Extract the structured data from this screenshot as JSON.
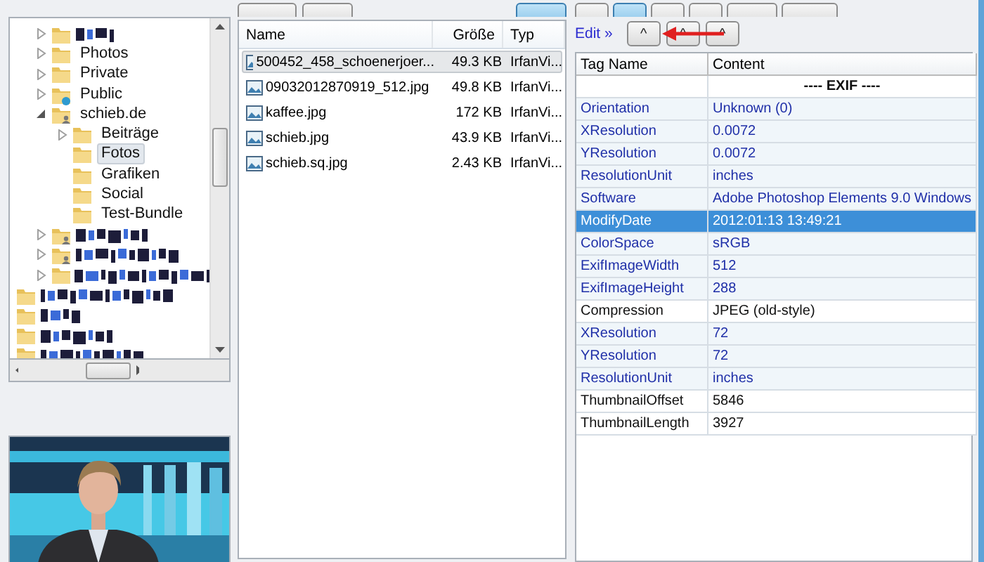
{
  "tree": {
    "items": [
      {
        "blurred": true,
        "expandable": true,
        "expanded": false,
        "kind": "folder"
      },
      {
        "label": "Photos",
        "expandable": true,
        "expanded": false,
        "kind": "folder",
        "selected": false
      },
      {
        "label": "Private",
        "expandable": true,
        "expanded": false,
        "kind": "folder",
        "selected": false
      },
      {
        "label": "Public",
        "expandable": true,
        "expanded": false,
        "kind": "public",
        "selected": false
      },
      {
        "label": "schieb.de",
        "expandable": true,
        "expanded": true,
        "kind": "shared",
        "selected": false,
        "children": [
          {
            "label": "Beiträge",
            "expandable": true,
            "expanded": false,
            "kind": "folder",
            "selected": false
          },
          {
            "label": "Fotos",
            "expandable": false,
            "kind": "folder",
            "selected": true
          },
          {
            "label": "Grafiken",
            "expandable": false,
            "kind": "folder",
            "selected": false
          },
          {
            "label": "Social",
            "expandable": false,
            "kind": "folder",
            "selected": false
          },
          {
            "label": "Test-Bundle",
            "expandable": false,
            "kind": "folder",
            "selected": false
          }
        ]
      },
      {
        "blurred": true,
        "expandable": true,
        "expanded": false,
        "kind": "shared"
      },
      {
        "blurred": true,
        "expandable": true,
        "expanded": false,
        "kind": "shared"
      },
      {
        "blurred": true,
        "expandable": true,
        "expanded": false,
        "kind": "folder"
      }
    ],
    "outer_items": [
      {
        "blurred": true,
        "kind": "folder"
      },
      {
        "blurred": true,
        "kind": "folder"
      },
      {
        "blurred": true,
        "kind": "folder"
      },
      {
        "blurred": true,
        "kind": "folder"
      }
    ]
  },
  "preview": {
    "kind": "picture"
  },
  "files": {
    "columns": [
      "Name",
      "Größe",
      "Typ"
    ],
    "rows": [
      {
        "name": "500452_458_schoenerjoer...",
        "size": "49.3 KB",
        "type": "IrfanVi...",
        "selected": true
      },
      {
        "name": "09032012870919_512.jpg",
        "size": "49.8 KB",
        "type": "IrfanVi...",
        "selected": false
      },
      {
        "name": "kaffee.jpg",
        "size": "172 KB",
        "type": "IrfanVi...",
        "selected": false
      },
      {
        "name": "schieb.jpg",
        "size": "43.9 KB",
        "type": "IrfanVi...",
        "selected": false
      },
      {
        "name": "schieb.sq.jpg",
        "size": "2.43 KB",
        "type": "IrfanVi...",
        "selected": false
      }
    ]
  },
  "meta_tabs": [
    {
      "selected": false
    },
    {
      "selected": true
    },
    {
      "selected": false
    },
    {
      "selected": false
    },
    {
      "selected": false
    },
    {
      "selected": false
    }
  ],
  "edit_link": "Edit »",
  "edit_buttons": [
    "^",
    "^",
    "^"
  ],
  "tags": {
    "columns": [
      "Tag Name",
      "Content"
    ],
    "rows": [
      {
        "kind": "section",
        "content": "---- EXIF ----"
      },
      {
        "kind": "tag",
        "name": "Orientation",
        "content": "Unknown (0)",
        "editable": true,
        "selected": false
      },
      {
        "kind": "tag",
        "name": "XResolution",
        "content": "0.0072",
        "editable": true,
        "selected": false
      },
      {
        "kind": "tag",
        "name": "YResolution",
        "content": "0.0072",
        "editable": true,
        "selected": false
      },
      {
        "kind": "tag",
        "name": "ResolutionUnit",
        "content": "inches",
        "editable": true,
        "selected": false
      },
      {
        "kind": "tag",
        "name": "Software",
        "content": "Adobe Photoshop Elements 9.0 Windows",
        "editable": true,
        "selected": false
      },
      {
        "kind": "tag",
        "name": "ModifyDate",
        "content": "2012:01:13 13:49:21",
        "editable": true,
        "selected": true
      },
      {
        "kind": "tag",
        "name": "ColorSpace",
        "content": "sRGB",
        "editable": true,
        "selected": false
      },
      {
        "kind": "tag",
        "name": "ExifImageWidth",
        "content": "512",
        "editable": true,
        "selected": false
      },
      {
        "kind": "tag",
        "name": "ExifImageHeight",
        "content": "288",
        "editable": true,
        "selected": false
      },
      {
        "kind": "tag",
        "name": "Compression",
        "content": "JPEG (old-style)",
        "editable": false,
        "selected": false
      },
      {
        "kind": "tag",
        "name": "XResolution",
        "content": "72",
        "editable": true,
        "selected": false
      },
      {
        "kind": "tag",
        "name": "YResolution",
        "content": "72",
        "editable": true,
        "selected": false
      },
      {
        "kind": "tag",
        "name": "ResolutionUnit",
        "content": "inches",
        "editable": true,
        "selected": false
      },
      {
        "kind": "tag",
        "name": "ThumbnailOffset",
        "content": "5846",
        "editable": false,
        "selected": false
      },
      {
        "kind": "tag",
        "name": "ThumbnailLength",
        "content": "3927",
        "editable": false,
        "selected": false
      }
    ]
  }
}
